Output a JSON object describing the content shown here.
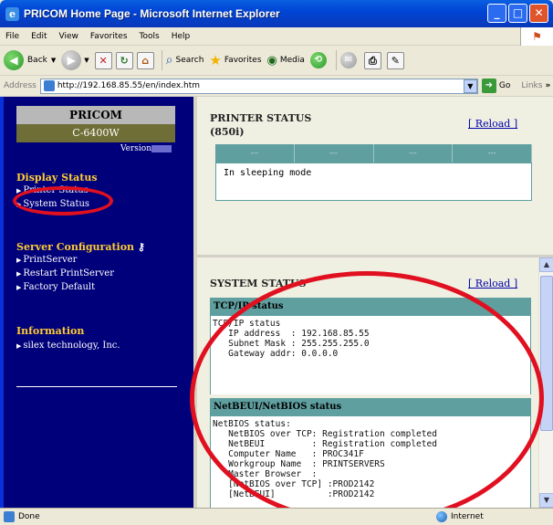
{
  "window": {
    "title": "PRICOM Home Page - Microsoft Internet Explorer",
    "controls": [
      "_",
      "□",
      "✕"
    ]
  },
  "menu": [
    "File",
    "Edit",
    "View",
    "Favorites",
    "Tools",
    "Help"
  ],
  "toolbar": {
    "back": "Back",
    "search": "Search",
    "favorites": "Favorites",
    "media": "Media"
  },
  "address": {
    "label": "Address",
    "url": "http://192.168.85.55/en/index.htm",
    "go": "Go",
    "links": "Links"
  },
  "left": {
    "brand": "PRICOM",
    "model": "C-6400W",
    "version_label": "Version",
    "sections": [
      {
        "title": "Display Status",
        "items": [
          "Printer Status",
          "System Status"
        ]
      },
      {
        "title": "Server Configuration",
        "items": [
          "PrintServer",
          "Restart PrintServer",
          "Factory Default"
        ]
      },
      {
        "title": "Information",
        "items": [
          "silex technology, Inc."
        ]
      }
    ]
  },
  "printer_status": {
    "title": "PRINTER STATUS",
    "model": "(850i)",
    "reload": "[ Reload ]",
    "header_cells": [
      "---",
      "---",
      "---",
      "---"
    ],
    "message": "In sleeping mode"
  },
  "system_status": {
    "title": "SYSTEM STATUS",
    "reload": "[ Reload ]",
    "tcpip": {
      "header": "TCP/IP status",
      "lines": "TCP/IP status\n   IP address  : 192.168.85.55\n   Subnet Mask : 255.255.255.0\n   Gateway addr: 0.0.0.0"
    },
    "netbeui": {
      "header": "NetBEUI/NetBIOS status",
      "lines": "NetBIOS status:\n   NetBIOS over TCP: Registration completed\n   NetBEUI         : Registration completed\n   Computer Name   : PROC341F\n   Workgroup Name  : PRINTSERVERS\n   Master Browser  :\n   [NetBIOS over TCP] :PROD2142\n   [NetBEUI]          :PROD2142"
    }
  },
  "statusbar": {
    "text": "Done",
    "zone": "Internet"
  },
  "colors": {
    "left_bg": "#00007a",
    "section_title": "#ffcc33",
    "table_header": "#5f9f9f",
    "annotation": "#e01020"
  }
}
